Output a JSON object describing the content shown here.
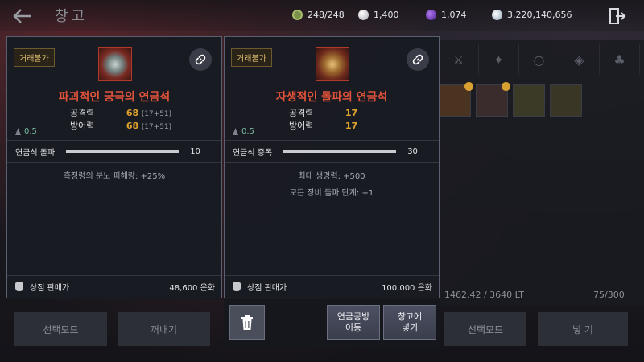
{
  "header": {
    "title": "창고",
    "currencies": [
      {
        "icon": "energy-icon",
        "value": "248/248",
        "color": "#8fa65a"
      },
      {
        "icon": "pearl-icon",
        "value": "1,400",
        "color": "#d8d8e0"
      },
      {
        "icon": "dark-crystal-icon",
        "value": "1,074",
        "color": "#7a3fd0"
      },
      {
        "icon": "silver-icon",
        "value": "3,220,140,656",
        "color": "#c9d6e2"
      }
    ]
  },
  "cards": [
    {
      "trade_label": "거래불가",
      "item_name": "파괴적인 궁극의 연금석",
      "icon_color": "#b03a2c",
      "stats": [
        {
          "label": "공격력",
          "value": "68",
          "extra": "(17+51)"
        },
        {
          "label": "방어력",
          "value": "68",
          "extra": "(17+51)"
        }
      ],
      "grade": "0.5",
      "property_label": "연금석 돌파",
      "property_value": "10",
      "descriptions": [
        "흑정령의 분노 피해량: +25%"
      ],
      "sell_label": "상점 판매가",
      "sell_price": "48,600 은화"
    },
    {
      "trade_label": "거래불가",
      "item_name": "자생적인 돌파의 연금석",
      "icon_color": "#b03a2c",
      "stats": [
        {
          "label": "공격력",
          "value": "17",
          "extra": ""
        },
        {
          "label": "방어력",
          "value": "17",
          "extra": ""
        }
      ],
      "grade": "0.5",
      "property_label": "연금석 증폭",
      "property_value": "30",
      "descriptions": [
        "최대 생명력: +500",
        "모든 장비 돌파 단계: +1"
      ],
      "sell_label": "상점 판매가",
      "sell_price": "100,000 은화"
    }
  ],
  "actions": {
    "alchemy_move": "연금공방\n이동",
    "store": "창고에\n넣기"
  },
  "background": {
    "left_buttons": [
      "선택모드",
      "꺼내기"
    ],
    "right_buttons": [
      "선택모드",
      "넣 기"
    ],
    "weight": "1462.42 / 3640 LT",
    "capacity": "75/300"
  }
}
